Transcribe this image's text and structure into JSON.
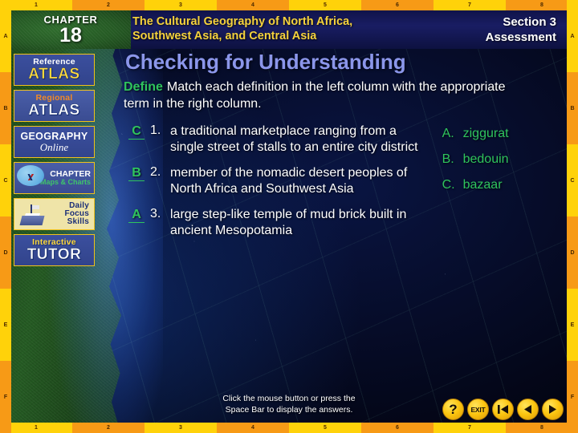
{
  "rulers": {
    "horizontal_ticks": [
      "1",
      "2",
      "3",
      "4",
      "5",
      "6",
      "7",
      "8"
    ],
    "vertical_ticks": [
      "A",
      "B",
      "C",
      "D",
      "E",
      "F"
    ]
  },
  "header": {
    "chapter_word": "CHAPTER",
    "chapter_number": "18",
    "book_title": "The Cultural Geography of North Africa, Southwest Asia, and Central Asia",
    "section_line1": "Section 3",
    "section_line2": "Assessment",
    "colors": {
      "title_yellow": "#f5d23c",
      "section_white": "#ffffff",
      "band_navy": "#191d63"
    }
  },
  "sidebar": {
    "items": [
      {
        "id": "reference-atlas",
        "top_label": "Reference",
        "big_label": "ATLAS"
      },
      {
        "id": "regional-atlas",
        "top_label": "Regional",
        "big_label": "ATLAS"
      },
      {
        "id": "geography-online",
        "top_label": "GEOGRAPHY",
        "big_label": "Online"
      },
      {
        "id": "chapter-maps-charts",
        "top_label": "CHAPTER",
        "big_label": "Maps & Charts"
      },
      {
        "id": "daily-focus-skills",
        "line1": "Daily",
        "line2": "Focus",
        "line3": "Skills"
      },
      {
        "id": "interactive-tutor",
        "top_label": "Interactive",
        "big_label": "TUTOR"
      }
    ]
  },
  "main": {
    "title": "Checking for Understanding",
    "define_label": "Define",
    "define_instruction": "Match each definition in the left column with the appropriate term in the right column.",
    "questions": [
      {
        "answer": "C",
        "number": "1.",
        "text": "a traditional marketplace ranging from a single street of stalls to an entire city district"
      },
      {
        "answer": "B",
        "number": "2.",
        "text": "member of the nomadic desert peoples of North Africa and Southwest Asia"
      },
      {
        "answer": "A",
        "number": "3.",
        "text": "large step-like temple of mud brick built in ancient Mesopotamia"
      }
    ],
    "terms": [
      {
        "letter": "A.",
        "word": "ziggurat"
      },
      {
        "letter": "B.",
        "word": "bedouin"
      },
      {
        "letter": "C.",
        "word": "bazaar"
      }
    ],
    "colors": {
      "title_periwinkle": "#8b96ea",
      "accent_green": "#2fc45d",
      "body_white": "#ffffff"
    }
  },
  "footer": {
    "hint_line1": "Click the mouse button or press the",
    "hint_line2": "Space Bar to display the answers.",
    "nav_buttons": [
      {
        "id": "help",
        "label": "?",
        "icon": "question-mark-icon"
      },
      {
        "id": "exit",
        "label": "EXIT",
        "icon": "exit-icon"
      },
      {
        "id": "first",
        "label": "",
        "icon": "skip-to-start-icon"
      },
      {
        "id": "previous",
        "label": "",
        "icon": "previous-arrow-icon"
      },
      {
        "id": "next",
        "label": "",
        "icon": "next-arrow-icon"
      }
    ]
  }
}
